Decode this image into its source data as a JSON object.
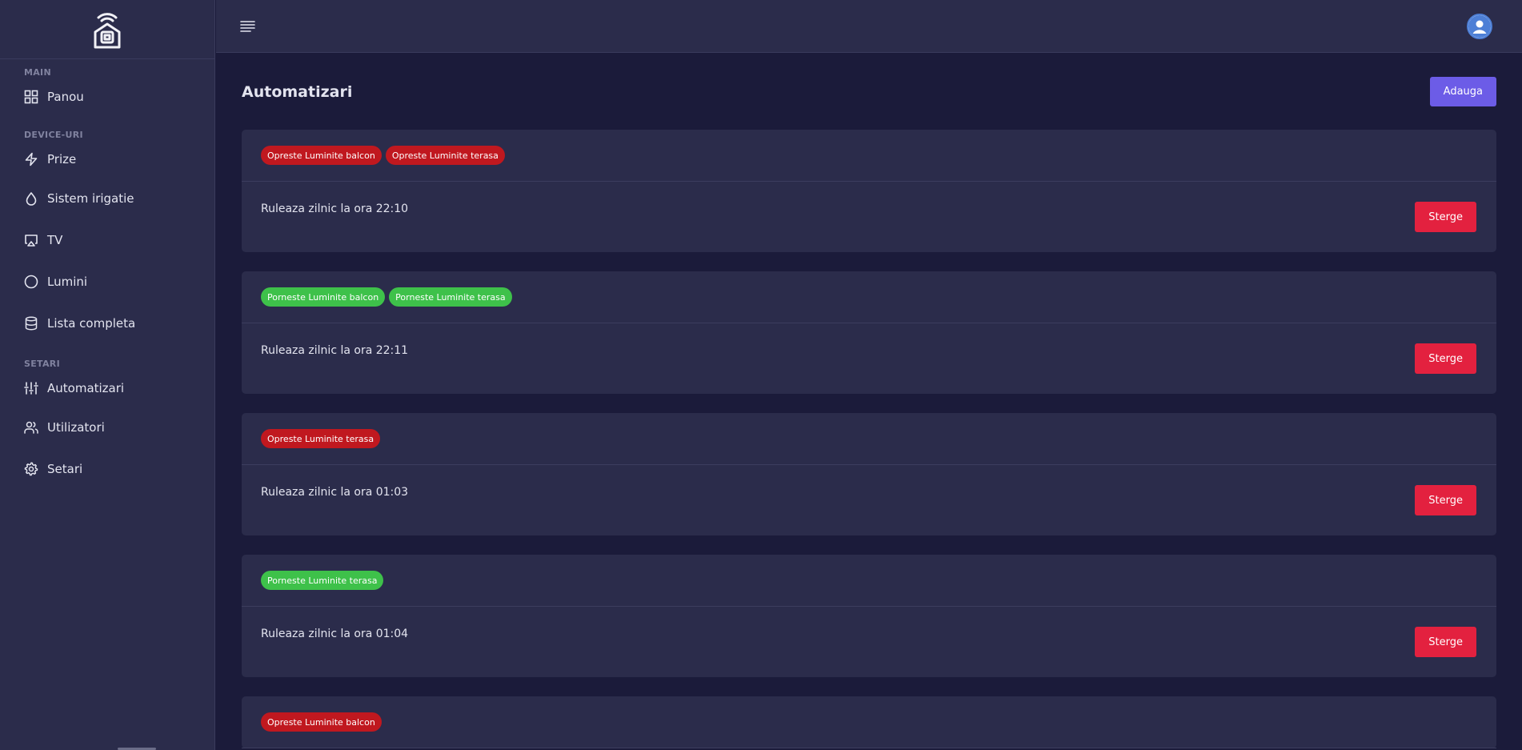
{
  "sidebar": {
    "logo_icon": "smart-home-chip-icon",
    "sections": [
      {
        "label": "MAIN"
      },
      {
        "label": "DEVICE-URI"
      },
      {
        "label": "SETARI"
      }
    ],
    "items": [
      {
        "label": "Panou",
        "icon": "grid-icon"
      },
      {
        "label": "Prize",
        "icon": "lightning-icon"
      },
      {
        "label": "Sistem irigatie",
        "icon": "droplet-icon"
      },
      {
        "label": "TV",
        "icon": "tv-icon"
      },
      {
        "label": "Lumini",
        "icon": "circle-icon"
      },
      {
        "label": "Lista completa",
        "icon": "database-icon"
      },
      {
        "label": "Automatizari",
        "icon": "sliders-icon"
      },
      {
        "label": "Utilizatori",
        "icon": "users-icon"
      },
      {
        "label": "Setari",
        "icon": "gear-icon"
      }
    ]
  },
  "topbar": {
    "menu_icon": "menu-icon",
    "avatar_icon": "user-avatar-icon"
  },
  "page": {
    "title": "Automatizari",
    "add_label": "Adauga"
  },
  "colors": {
    "background": "#1b1b3a",
    "panel": "#2b2c4b",
    "primary": "#6c5ce7",
    "danger": "#e3213f",
    "badge_off": "#c0181f",
    "badge_on": "#3ec14a"
  },
  "automations": [
    {
      "badges": [
        {
          "text": "Opreste Luminite balcon",
          "state": "off"
        },
        {
          "text": "Opreste Luminite terasa",
          "state": "off"
        }
      ],
      "schedule": "Ruleaza zilnic la ora 22:10",
      "delete_label": "Sterge"
    },
    {
      "badges": [
        {
          "text": "Porneste Luminite balcon",
          "state": "on"
        },
        {
          "text": "Porneste Luminite terasa",
          "state": "on"
        }
      ],
      "schedule": "Ruleaza zilnic la ora 22:11",
      "delete_label": "Sterge"
    },
    {
      "badges": [
        {
          "text": "Opreste Luminite terasa",
          "state": "off"
        }
      ],
      "schedule": "Ruleaza zilnic la ora 01:03",
      "delete_label": "Sterge"
    },
    {
      "badges": [
        {
          "text": "Porneste Luminite terasa",
          "state": "on"
        }
      ],
      "schedule": "Ruleaza zilnic la ora 01:04",
      "delete_label": "Sterge"
    },
    {
      "badges": [
        {
          "text": "Opreste Luminite balcon",
          "state": "off"
        }
      ]
    }
  ]
}
